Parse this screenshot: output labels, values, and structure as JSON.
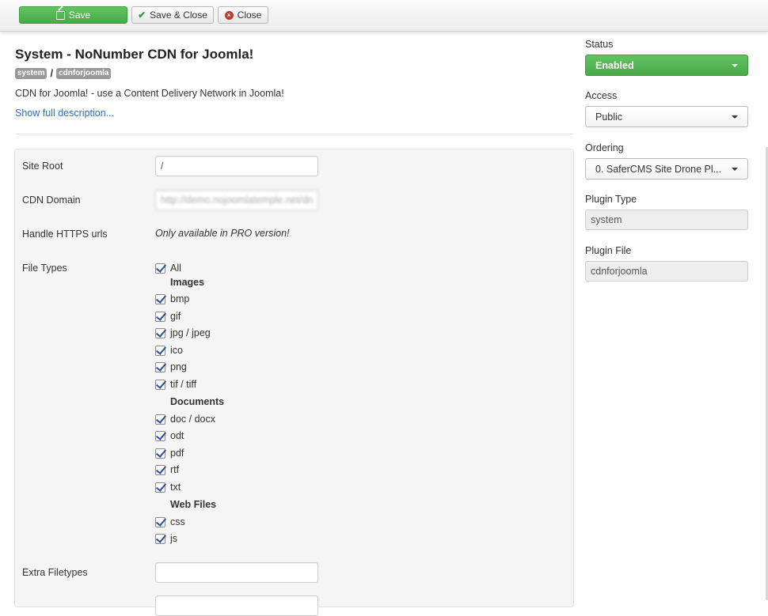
{
  "toolbar": {
    "save": "Save",
    "save_close": "Save & Close",
    "close": "Close"
  },
  "header": {
    "title": "System - NoNumber CDN for Joomla!",
    "tags": [
      "system",
      "cdnforjoomla"
    ],
    "separator": "/",
    "description": "CDN for Joomla! - use a Content Delivery Network in Joomla!",
    "show_more": "Show full description..."
  },
  "form": {
    "site_root": {
      "label": "Site Root",
      "value": "/"
    },
    "cdn_domain": {
      "label": "CDN Domain",
      "value": "http://demo.nojoomlatemple.net/dn"
    },
    "https": {
      "label": "Handle HTTPS urls",
      "note": "Only available in PRO version!"
    },
    "file_types": {
      "label": "File Types",
      "all": "All",
      "images_title": "Images",
      "images": [
        "bmp",
        "gif",
        "jpg / jpeg",
        "ico",
        "png",
        "tif / tiff"
      ],
      "documents_title": "Documents",
      "documents": [
        "doc / docx",
        "odt",
        "pdf",
        "rtf",
        "txt"
      ],
      "web_title": "Web Files",
      "web": [
        "css",
        "js"
      ]
    },
    "extra": {
      "label": "Extra Filetypes",
      "value": ""
    }
  },
  "sidebar": {
    "status": {
      "label": "Status",
      "value": "Enabled"
    },
    "access": {
      "label": "Access",
      "value": "Public"
    },
    "ordering": {
      "label": "Ordering",
      "value": "0. SaferCMS Site Drone Pl..."
    },
    "plugin_type": {
      "label": "Plugin Type",
      "value": "system"
    },
    "plugin_file": {
      "label": "Plugin File",
      "value": "cdnforjoomla"
    }
  },
  "colors": {
    "green": "#5bb75b",
    "link": "#2f6fb3",
    "checkbox": "#2d4f9e"
  }
}
